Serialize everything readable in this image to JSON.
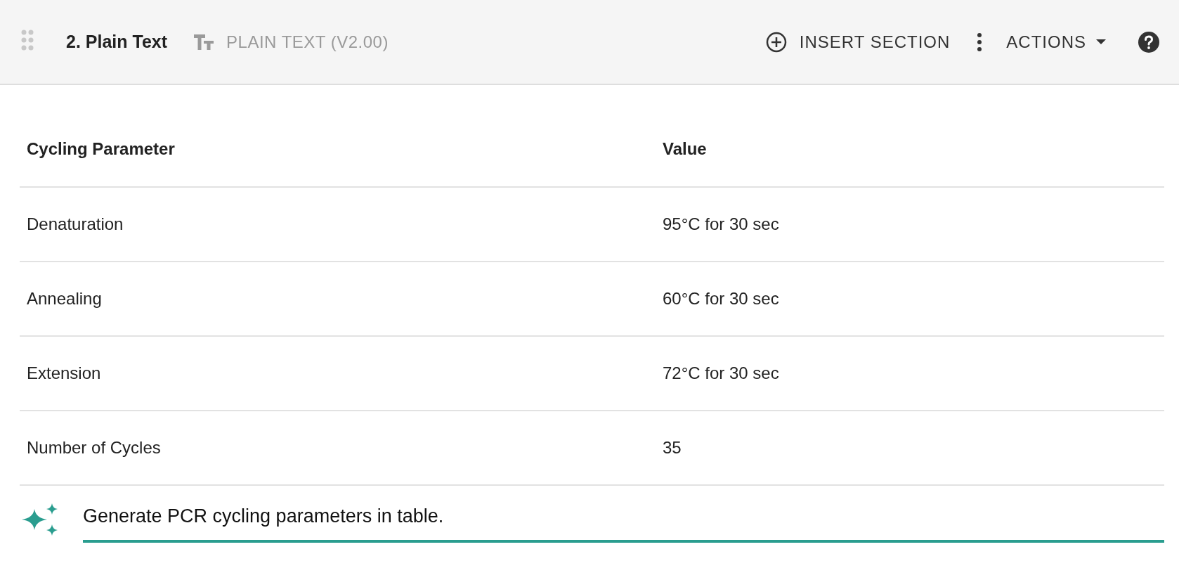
{
  "section_header": {
    "title": "2. Plain Text",
    "type_label": "PLAIN TEXT (V2.00)",
    "insert_button": "INSERT SECTION",
    "actions_button": "ACTIONS"
  },
  "table": {
    "columns": [
      "Cycling Parameter",
      "Value"
    ],
    "rows": [
      [
        "Denaturation",
        "95°C for 30 sec"
      ],
      [
        "Annealing",
        "60°C for 30 sec"
      ],
      [
        "Extension",
        "72°C for 30 sec"
      ],
      [
        "Number of Cycles",
        "35"
      ]
    ]
  },
  "prompt": {
    "value": "Generate PCR cycling parameters in table."
  }
}
